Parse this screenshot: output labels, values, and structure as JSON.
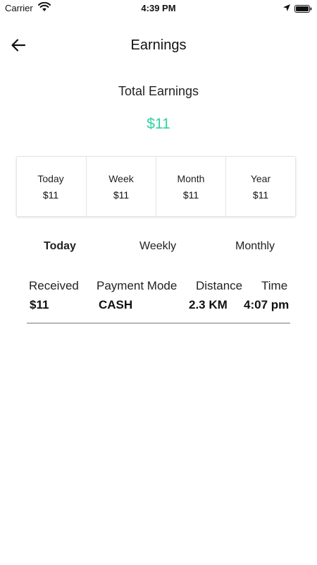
{
  "status_bar": {
    "carrier": "Carrier",
    "time": "4:39 PM",
    "icons": [
      "wifi-icon",
      "location-arrow-icon",
      "battery-icon"
    ]
  },
  "header": {
    "back_icon": "arrow-left-icon",
    "title": "Earnings"
  },
  "total": {
    "label": "Total Earnings",
    "amount": "$11",
    "amount_color": "#2ed3a0"
  },
  "summary": [
    {
      "period": "Today",
      "value": "$11"
    },
    {
      "period": "Week",
      "value": "$11"
    },
    {
      "period": "Month",
      "value": "$11"
    },
    {
      "period": "Year",
      "value": "$11"
    }
  ],
  "tabs": [
    {
      "label": "Today",
      "active": true
    },
    {
      "label": "Weekly",
      "active": false
    },
    {
      "label": "Monthly",
      "active": false
    }
  ],
  "table": {
    "columns": [
      "Received",
      "Payment Mode",
      "Distance",
      "Time"
    ],
    "rows": [
      [
        "$11",
        "CASH",
        "2.3 KM",
        "4:07 pm"
      ]
    ]
  }
}
